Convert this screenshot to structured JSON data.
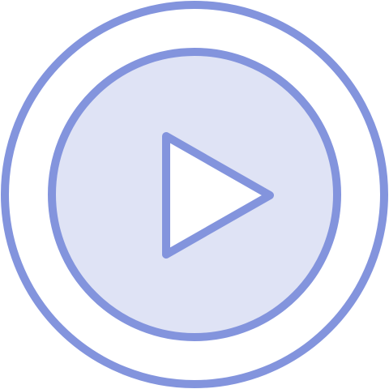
{
  "icon": {
    "name": "play-icon",
    "colors": {
      "stroke": "#8394DD",
      "inner_fill": "#DFE3F5",
      "triangle_fill": "#FFFFFF",
      "background": "#FFFFFF"
    }
  }
}
